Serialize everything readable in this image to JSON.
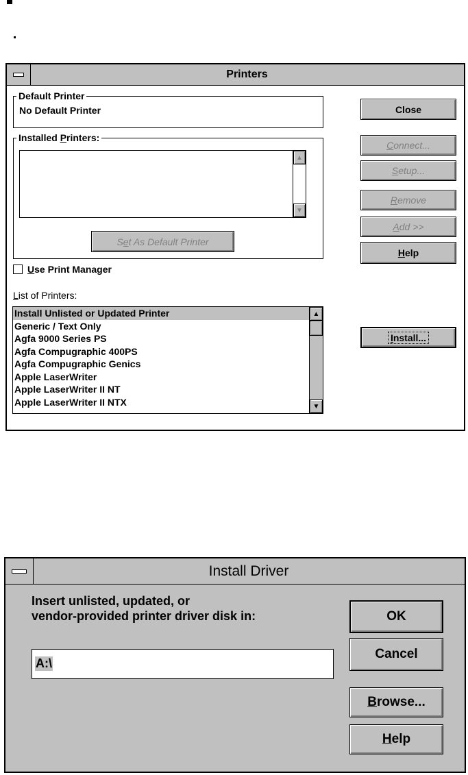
{
  "printers_dialog": {
    "title": "Printers",
    "default_printer": {
      "label": "Default Printer",
      "value": "No Default Printer"
    },
    "installed_printers": {
      "label_prefix": "Installed ",
      "label_accel": "P",
      "label_suffix": "rinters:",
      "items": []
    },
    "set_default": {
      "prefix": "S",
      "accel": "e",
      "suffix": "t As Default Printer"
    },
    "use_print_manager": {
      "accel": "U",
      "suffix": "se Print Manager",
      "checked": false
    },
    "list_of_printers": {
      "label_accel": "L",
      "label_suffix": "ist of Printers:",
      "items": [
        "Install Unlisted or Updated Printer",
        "Generic / Text Only",
        "Agfa 9000 Series PS",
        "Agfa Compugraphic 400PS",
        "Agfa Compugraphic Genics",
        "Apple LaserWriter",
        "Apple LaserWriter II NT",
        "Apple LaserWriter II NTX"
      ],
      "selected_index": 0
    },
    "buttons": {
      "close": "Close",
      "connect": {
        "accel": "C",
        "suffix": "onnect..."
      },
      "setup": {
        "accel": "S",
        "suffix": "etup..."
      },
      "remove": {
        "accel": "R",
        "suffix": "emove"
      },
      "add": {
        "accel": "A",
        "suffix": "dd >>"
      },
      "help": {
        "accel": "H",
        "suffix": "elp"
      },
      "install": {
        "accel": "I",
        "suffix": "nstall..."
      }
    }
  },
  "install_driver_dialog": {
    "title": "Install Driver",
    "prompt_line1": "Insert unlisted, updated, or",
    "prompt_line2": "vendor-provided printer driver disk in:",
    "path_value": "A:\\",
    "buttons": {
      "ok": "OK",
      "cancel": "Cancel",
      "browse": {
        "accel": "B",
        "suffix": "rowse..."
      },
      "help": {
        "accel": "H",
        "suffix": "elp"
      }
    }
  },
  "colors": {
    "face": "#c0c0c0",
    "shadow": "#808080",
    "highlight": "#ffffff",
    "frame": "#000000"
  }
}
